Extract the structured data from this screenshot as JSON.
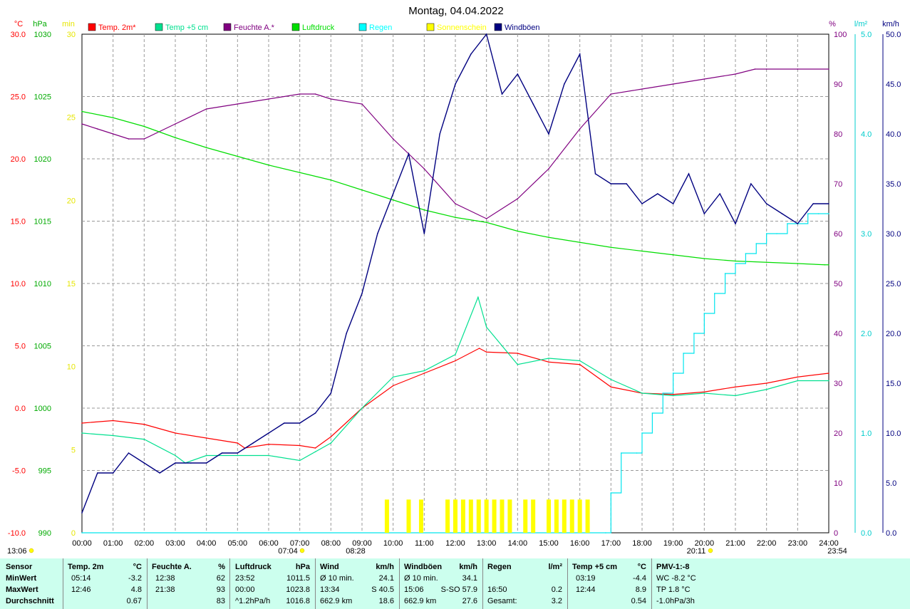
{
  "chart_data": {
    "type": "line",
    "title": "Montag, 04.04.2022",
    "x": [
      "00:00",
      "01:00",
      "02:00",
      "03:00",
      "04:00",
      "05:00",
      "06:00",
      "07:00",
      "08:00",
      "09:00",
      "10:00",
      "11:00",
      "12:00",
      "13:00",
      "14:00",
      "15:00",
      "16:00",
      "17:00",
      "18:00",
      "19:00",
      "20:00",
      "21:00",
      "22:00",
      "23:00",
      "24:00"
    ],
    "axes": {
      "temp": {
        "unit": "°C",
        "ylim": [
          -10,
          30
        ],
        "ticks": [
          "30.0",
          "25.0",
          "20.0",
          "15.0",
          "10.0",
          "5.0",
          "0.0",
          "-5.0",
          "-10.0"
        ],
        "color": "#ff0000"
      },
      "pressure": {
        "unit": "hPa",
        "ylim": [
          990,
          1030
        ],
        "ticks": [
          "1030",
          "1025",
          "1020",
          "1015",
          "1010",
          "1005",
          "1000",
          "995",
          "990"
        ],
        "color": "#00bb00"
      },
      "sunshine": {
        "unit": "min",
        "ylim": [
          0,
          30
        ],
        "ticks": [
          "30",
          "25",
          "20",
          "15",
          "10",
          "5",
          "0"
        ],
        "color": "#ffff00"
      },
      "humidity": {
        "unit": "%",
        "ylim": [
          0,
          100
        ],
        "ticks": [
          "100",
          "90",
          "80",
          "70",
          "60",
          "50",
          "40",
          "30",
          "20",
          "10",
          "0"
        ],
        "color": "#800080"
      },
      "rain": {
        "unit": "l/m²",
        "ylim": [
          0,
          5
        ],
        "ticks": [
          "5.0",
          "4.0",
          "3.0",
          "2.0",
          "1.0",
          "0.0"
        ],
        "color": "#00e5ee"
      },
      "wind": {
        "unit": "km/h",
        "ylim": [
          0,
          50
        ],
        "ticks": [
          "50.0",
          "45.0",
          "40.0",
          "35.0",
          "30.0",
          "25.0",
          "20.0",
          "15.0",
          "10.0",
          "5.0",
          "0.0"
        ],
        "color": "#000080"
      }
    },
    "legend": [
      {
        "name": "Temp. 2m*",
        "color": "#ff0000"
      },
      {
        "name": "Temp +5 cm",
        "color": "#00e08f"
      },
      {
        "name": "Feuchte A.*",
        "color": "#800080"
      },
      {
        "name": "Luftdruck",
        "color": "#00dd00"
      },
      {
        "name": "Regen",
        "color": "#00ffff"
      },
      {
        "name": "Sonnenschein",
        "color": "#ffff00"
      },
      {
        "name": "Windböen",
        "color": "#000080"
      }
    ],
    "series": [
      {
        "name": "Temp. 2m*",
        "axis": "temp",
        "color": "#ff0000",
        "x": [
          0,
          1,
          2,
          3,
          4,
          5,
          5.23,
          6,
          7,
          7.5,
          8,
          9,
          10,
          11,
          12,
          12.77,
          13,
          14,
          15,
          16,
          17,
          18,
          19,
          20,
          21,
          22,
          23,
          24
        ],
        "y": [
          -1.2,
          -1.0,
          -1.3,
          -2.0,
          -2.4,
          -2.8,
          -3.2,
          -2.9,
          -3.0,
          -3.2,
          -2.3,
          0.0,
          1.8,
          2.8,
          3.8,
          4.8,
          4.5,
          4.4,
          3.7,
          3.5,
          1.7,
          1.2,
          1.1,
          1.3,
          1.7,
          2.0,
          2.5,
          2.8
        ]
      },
      {
        "name": "Temp +5 cm",
        "axis": "temp",
        "color": "#00e08f",
        "x": [
          0,
          1,
          2,
          3,
          3.32,
          4,
          5,
          6,
          7,
          7.5,
          8,
          9,
          10,
          11,
          12,
          12.73,
          13,
          14,
          15,
          16,
          17,
          18,
          19,
          20,
          21,
          22,
          23,
          24
        ],
        "y": [
          -2.0,
          -2.2,
          -2.5,
          -3.8,
          -4.4,
          -3.8,
          -3.8,
          -3.8,
          -4.2,
          -3.5,
          -2.8,
          0.0,
          2.5,
          3.0,
          4.3,
          8.9,
          6.5,
          3.5,
          4.0,
          3.8,
          2.3,
          1.2,
          1.0,
          1.2,
          1.0,
          1.5,
          2.2,
          2.2
        ]
      },
      {
        "name": "Feuchte A.*",
        "axis": "humidity",
        "color": "#800080",
        "x": [
          0,
          0.5,
          1,
          1.5,
          2,
          3,
          4,
          5,
          6,
          7,
          7.5,
          8,
          9,
          10,
          11,
          12,
          13,
          14,
          15,
          16,
          17,
          18,
          19,
          20,
          21,
          21.63,
          22,
          23,
          24
        ],
        "y": [
          82,
          81,
          80,
          79,
          79,
          82,
          85,
          86,
          87,
          88,
          88,
          87,
          86,
          79,
          73,
          66,
          63,
          67,
          73,
          81,
          88,
          89,
          90,
          91,
          92,
          93,
          93,
          93,
          93
        ]
      },
      {
        "name": "Luftdruck",
        "axis": "pressure",
        "color": "#00dd00",
        "x": [
          0,
          1,
          2,
          3,
          4,
          5,
          6,
          7,
          8,
          9,
          10,
          11,
          12,
          13,
          14,
          15,
          16,
          17,
          18,
          19,
          20,
          21,
          22,
          23,
          23.87,
          24
        ],
        "y": [
          1023.8,
          1023.3,
          1022.6,
          1021.7,
          1020.9,
          1020.2,
          1019.5,
          1018.9,
          1018.3,
          1017.5,
          1016.7,
          1015.9,
          1015.3,
          1014.9,
          1014.2,
          1013.7,
          1013.3,
          1012.9,
          1012.6,
          1012.3,
          1012.0,
          1011.8,
          1011.7,
          1011.6,
          1011.5,
          1011.5
        ]
      },
      {
        "name": "Regen",
        "axis": "rain",
        "color": "#00e5ee",
        "x": [
          0,
          16.83,
          17,
          17.33,
          17.83,
          18,
          18.33,
          18.67,
          19,
          19.33,
          19.67,
          20,
          20.33,
          20.67,
          21,
          21.33,
          21.67,
          22,
          22.33,
          22.67,
          23,
          23.33,
          23.67,
          24
        ],
        "y": [
          0,
          0,
          0.4,
          0.8,
          0.8,
          1.0,
          1.2,
          1.4,
          1.6,
          1.8,
          2.0,
          2.2,
          2.4,
          2.6,
          2.7,
          2.8,
          2.9,
          3.0,
          3.0,
          3.1,
          3.1,
          3.2,
          3.2,
          3.2
        ]
      },
      {
        "name": "Windböen",
        "axis": "wind",
        "color": "#000080",
        "x": [
          0,
          0.5,
          1,
          1.5,
          2,
          2.5,
          3,
          3.5,
          4,
          4.5,
          5,
          5.5,
          6,
          6.5,
          7,
          7.5,
          8,
          8.5,
          9,
          9.5,
          10,
          10.5,
          11,
          11.5,
          12,
          12.5,
          13,
          13.5,
          14,
          14.5,
          15,
          15.5,
          16,
          16.5,
          17,
          17.5,
          18,
          18.5,
          19,
          19.5,
          20,
          20.5,
          21,
          21.5,
          22,
          22.5,
          23,
          23.5,
          24
        ],
        "y": [
          2,
          6,
          6,
          8,
          7,
          6,
          7,
          7,
          7,
          8,
          8,
          9,
          10,
          11,
          11,
          12,
          14,
          20,
          24,
          30,
          34,
          38,
          30,
          40,
          45,
          48,
          50,
          44,
          46,
          43,
          40,
          45,
          48,
          36,
          35,
          35,
          33,
          34,
          33,
          36,
          32,
          34,
          31,
          35,
          33,
          32,
          31,
          33,
          33
        ]
      },
      {
        "name": "Sonnenschein",
        "axis": "sunshine",
        "color": "#ffff00",
        "x": [
          9.8,
          10.5,
          10.9,
          11.75,
          12.0,
          12.25,
          12.5,
          12.75,
          13.0,
          13.25,
          13.5,
          13.75,
          14.0,
          14.25,
          14.5,
          14.75,
          15.0,
          15.25,
          15.5,
          15.75,
          16.0,
          16.25
        ],
        "y": [
          2,
          2,
          2,
          2,
          2,
          2,
          2,
          2,
          2,
          2,
          2,
          2,
          0,
          2,
          2,
          0,
          2,
          2,
          2,
          2,
          2,
          2
        ]
      }
    ],
    "markers": [
      {
        "label": "13:06",
        "axis": "bottom-left"
      },
      {
        "label": "07:04"
      },
      {
        "label": "08:28"
      },
      {
        "label": "20:11"
      },
      {
        "label": "23:54"
      }
    ],
    "grid": true,
    "legend_position": "top"
  },
  "table": {
    "headers": {
      "sensor": "Sensor",
      "temp2m": "Temp. 2m",
      "temp2m_unit": "°C",
      "feuchte": "Feuchte A.",
      "feuchte_unit": "%",
      "luftdruck": "Luftdruck",
      "luftdruck_unit": "hPa",
      "wind": "Wind",
      "wind_unit": "km/h",
      "boeen": "Windböen",
      "boeen_unit": "km/h",
      "regen": "Regen",
      "regen_unit": "l/m²",
      "temp5": "Temp +5 cm",
      "temp5_unit": "°C",
      "pmv": "PMV-1:-8"
    },
    "rows": [
      {
        "label": "MinWert",
        "t2_time": "05:14",
        "t2_val": "-3.2",
        "f_time": "12:38",
        "f_val": "62",
        "l_time": "23:52",
        "l_val": "1011.5",
        "w_time": "Ø 10 min.",
        "w_val": "24.1",
        "b_time": "Ø 10 min.",
        "b_val": "34.1",
        "r_time": "",
        "r_val": "",
        "t5_time": "03:19",
        "t5_val": "-4.4",
        "pmv": "WC -8.2 °C"
      },
      {
        "label": "MaxWert",
        "t2_time": "12:46",
        "t2_val": "4.8",
        "f_time": "21:38",
        "f_val": "93",
        "l_time": "00:00",
        "l_val": "1023.8",
        "w_time": "13:34",
        "w_val": "S 40.5",
        "b_time": "15:06",
        "b_val": "S-SO 57.9",
        "r_time": "16:50",
        "r_val": "0.2",
        "t5_time": "12:44",
        "t5_val": "8.9",
        "pmv": "TP 1.8 °C"
      },
      {
        "label": "Durchschnitt",
        "t2_time": "",
        "t2_val": "0.67",
        "f_time": "",
        "f_val": "83",
        "l_time": "^1.2hPa/h",
        "l_val": "1016.8",
        "w_time": "662.9 km",
        "w_val": "18.6",
        "b_time": "662.9 km",
        "b_val": "27.6",
        "r_time": "Gesamt:",
        "r_val": "3.2",
        "t5_time": "",
        "t5_val": "0.54",
        "pmv": "-1.0hPa/3h"
      }
    ]
  }
}
